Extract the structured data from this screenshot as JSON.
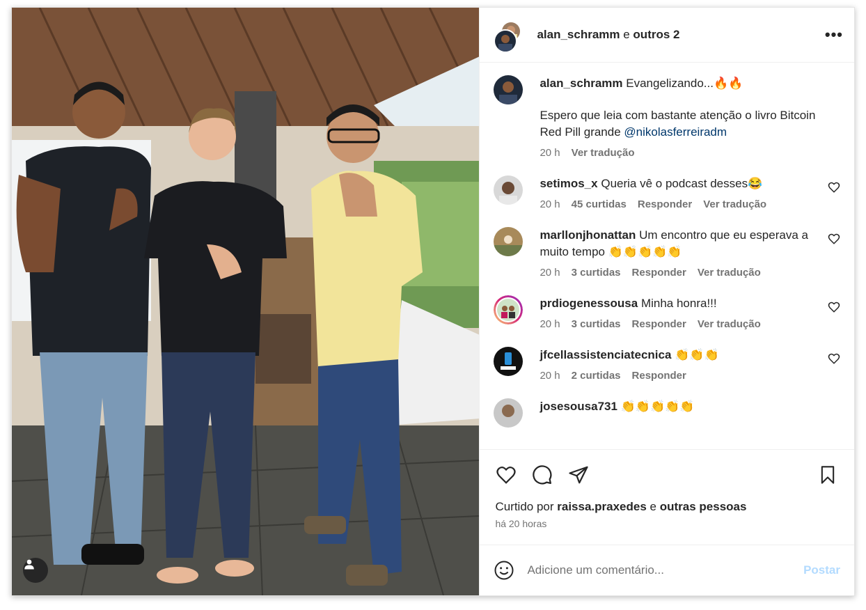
{
  "header": {
    "username": "alan_schramm",
    "connector": " e ",
    "others": "outros 2",
    "more_glyph": "•••"
  },
  "caption": {
    "username": "alan_schramm",
    "text_line1": "Evangelizando...🔥🔥",
    "text_line2": "Espero que leia com bastante atenção o livro Bitcoin Red Pill grande ",
    "mention": "@nikolasferreiradm",
    "time": "20 h",
    "translate": "Ver tradução"
  },
  "comments": [
    {
      "username": "setimos_x",
      "text": "Queria vê o podcast desses😂",
      "time": "20 h",
      "likes": "45 curtidas",
      "reply": "Responder",
      "translate": "Ver tradução"
    },
    {
      "username": "marllonjhonattan",
      "text": "Um encontro que eu esperava a muito tempo 👏👏👏👏👏",
      "time": "20 h",
      "likes": "3 curtidas",
      "reply": "Responder",
      "translate": "Ver tradução"
    },
    {
      "username": "prdiogenessousa",
      "text": "Minha honra!!!",
      "time": "20 h",
      "likes": "3 curtidas",
      "reply": "Responder",
      "translate": "Ver tradução"
    },
    {
      "username": "jfcellassistenciatecnica",
      "text": "👏👏👏",
      "time": "20 h",
      "likes": "2 curtidas",
      "reply": "Responder"
    },
    {
      "username": "josesousa731",
      "text": "👏👏👏👏👏"
    }
  ],
  "likes": {
    "prefix": "Curtido por ",
    "user": "raissa.praxedes",
    "connector": " e ",
    "others": "outras pessoas"
  },
  "timestamp": "há 20 horas",
  "add_comment": {
    "placeholder": "Adicione um comentário...",
    "post_label": "Postar"
  },
  "icons": {
    "like": "heart-icon",
    "comment": "comment-icon",
    "share": "send-icon",
    "save": "bookmark-icon",
    "emoji": "emoji-icon",
    "tag": "user-tag-icon"
  },
  "colors": {
    "mention": "#00376b",
    "post_disabled": "#b3dbff",
    "meta": "#737373",
    "text": "#262626"
  }
}
